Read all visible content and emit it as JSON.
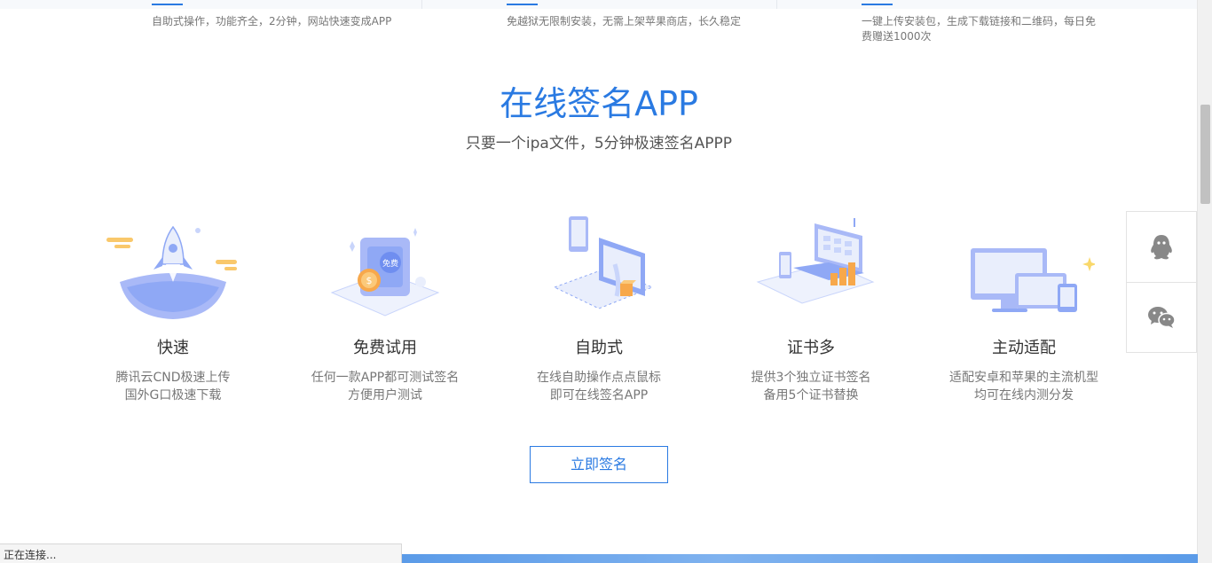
{
  "top_features": [
    {
      "text": "自助式操作，功能齐全，2分钟，网站快速变成APP"
    },
    {
      "text": "免越狱无限制安装，无需上架苹果商店，长久稳定"
    },
    {
      "text": "一键上传安装包，生成下载链接和二维码，每日免费赠送1000次"
    }
  ],
  "section": {
    "title": "在线签名APP",
    "subtitle": "只要一个ipa文件，5分钟极速签名APPP"
  },
  "features": [
    {
      "name": "快速",
      "desc1": "腾讯云CND极速上传",
      "desc2": "国外G口极速下载",
      "icon": "rocket-illustration"
    },
    {
      "name": "免费试用",
      "desc1": "任何一款APP都可测试签名",
      "desc2": "方便用户测试",
      "icon": "free-trial-illustration"
    },
    {
      "name": "自助式",
      "desc1": "在线自助操作点点鼠标",
      "desc2": "即可在线签名APP",
      "icon": "self-service-illustration"
    },
    {
      "name": "证书多",
      "desc1": "提供3个独立证书签名",
      "desc2": "备用5个证书替换",
      "icon": "certificates-illustration"
    },
    {
      "name": "主动适配",
      "desc1": "适配安卓和苹果的主流机型",
      "desc2": "均可在线内测分发",
      "icon": "device-adapt-illustration"
    }
  ],
  "cta": {
    "label": "立即签名"
  },
  "illustration_badge": "免费",
  "float_contacts": [
    {
      "icon": "qq-icon"
    },
    {
      "icon": "wechat-icon"
    }
  ],
  "status_bar": {
    "text": "正在连接..."
  },
  "colors": {
    "accent": "#2a7ae2",
    "illustration_blue": "#8fa8f5",
    "illustration_orange": "#f7a84b"
  }
}
